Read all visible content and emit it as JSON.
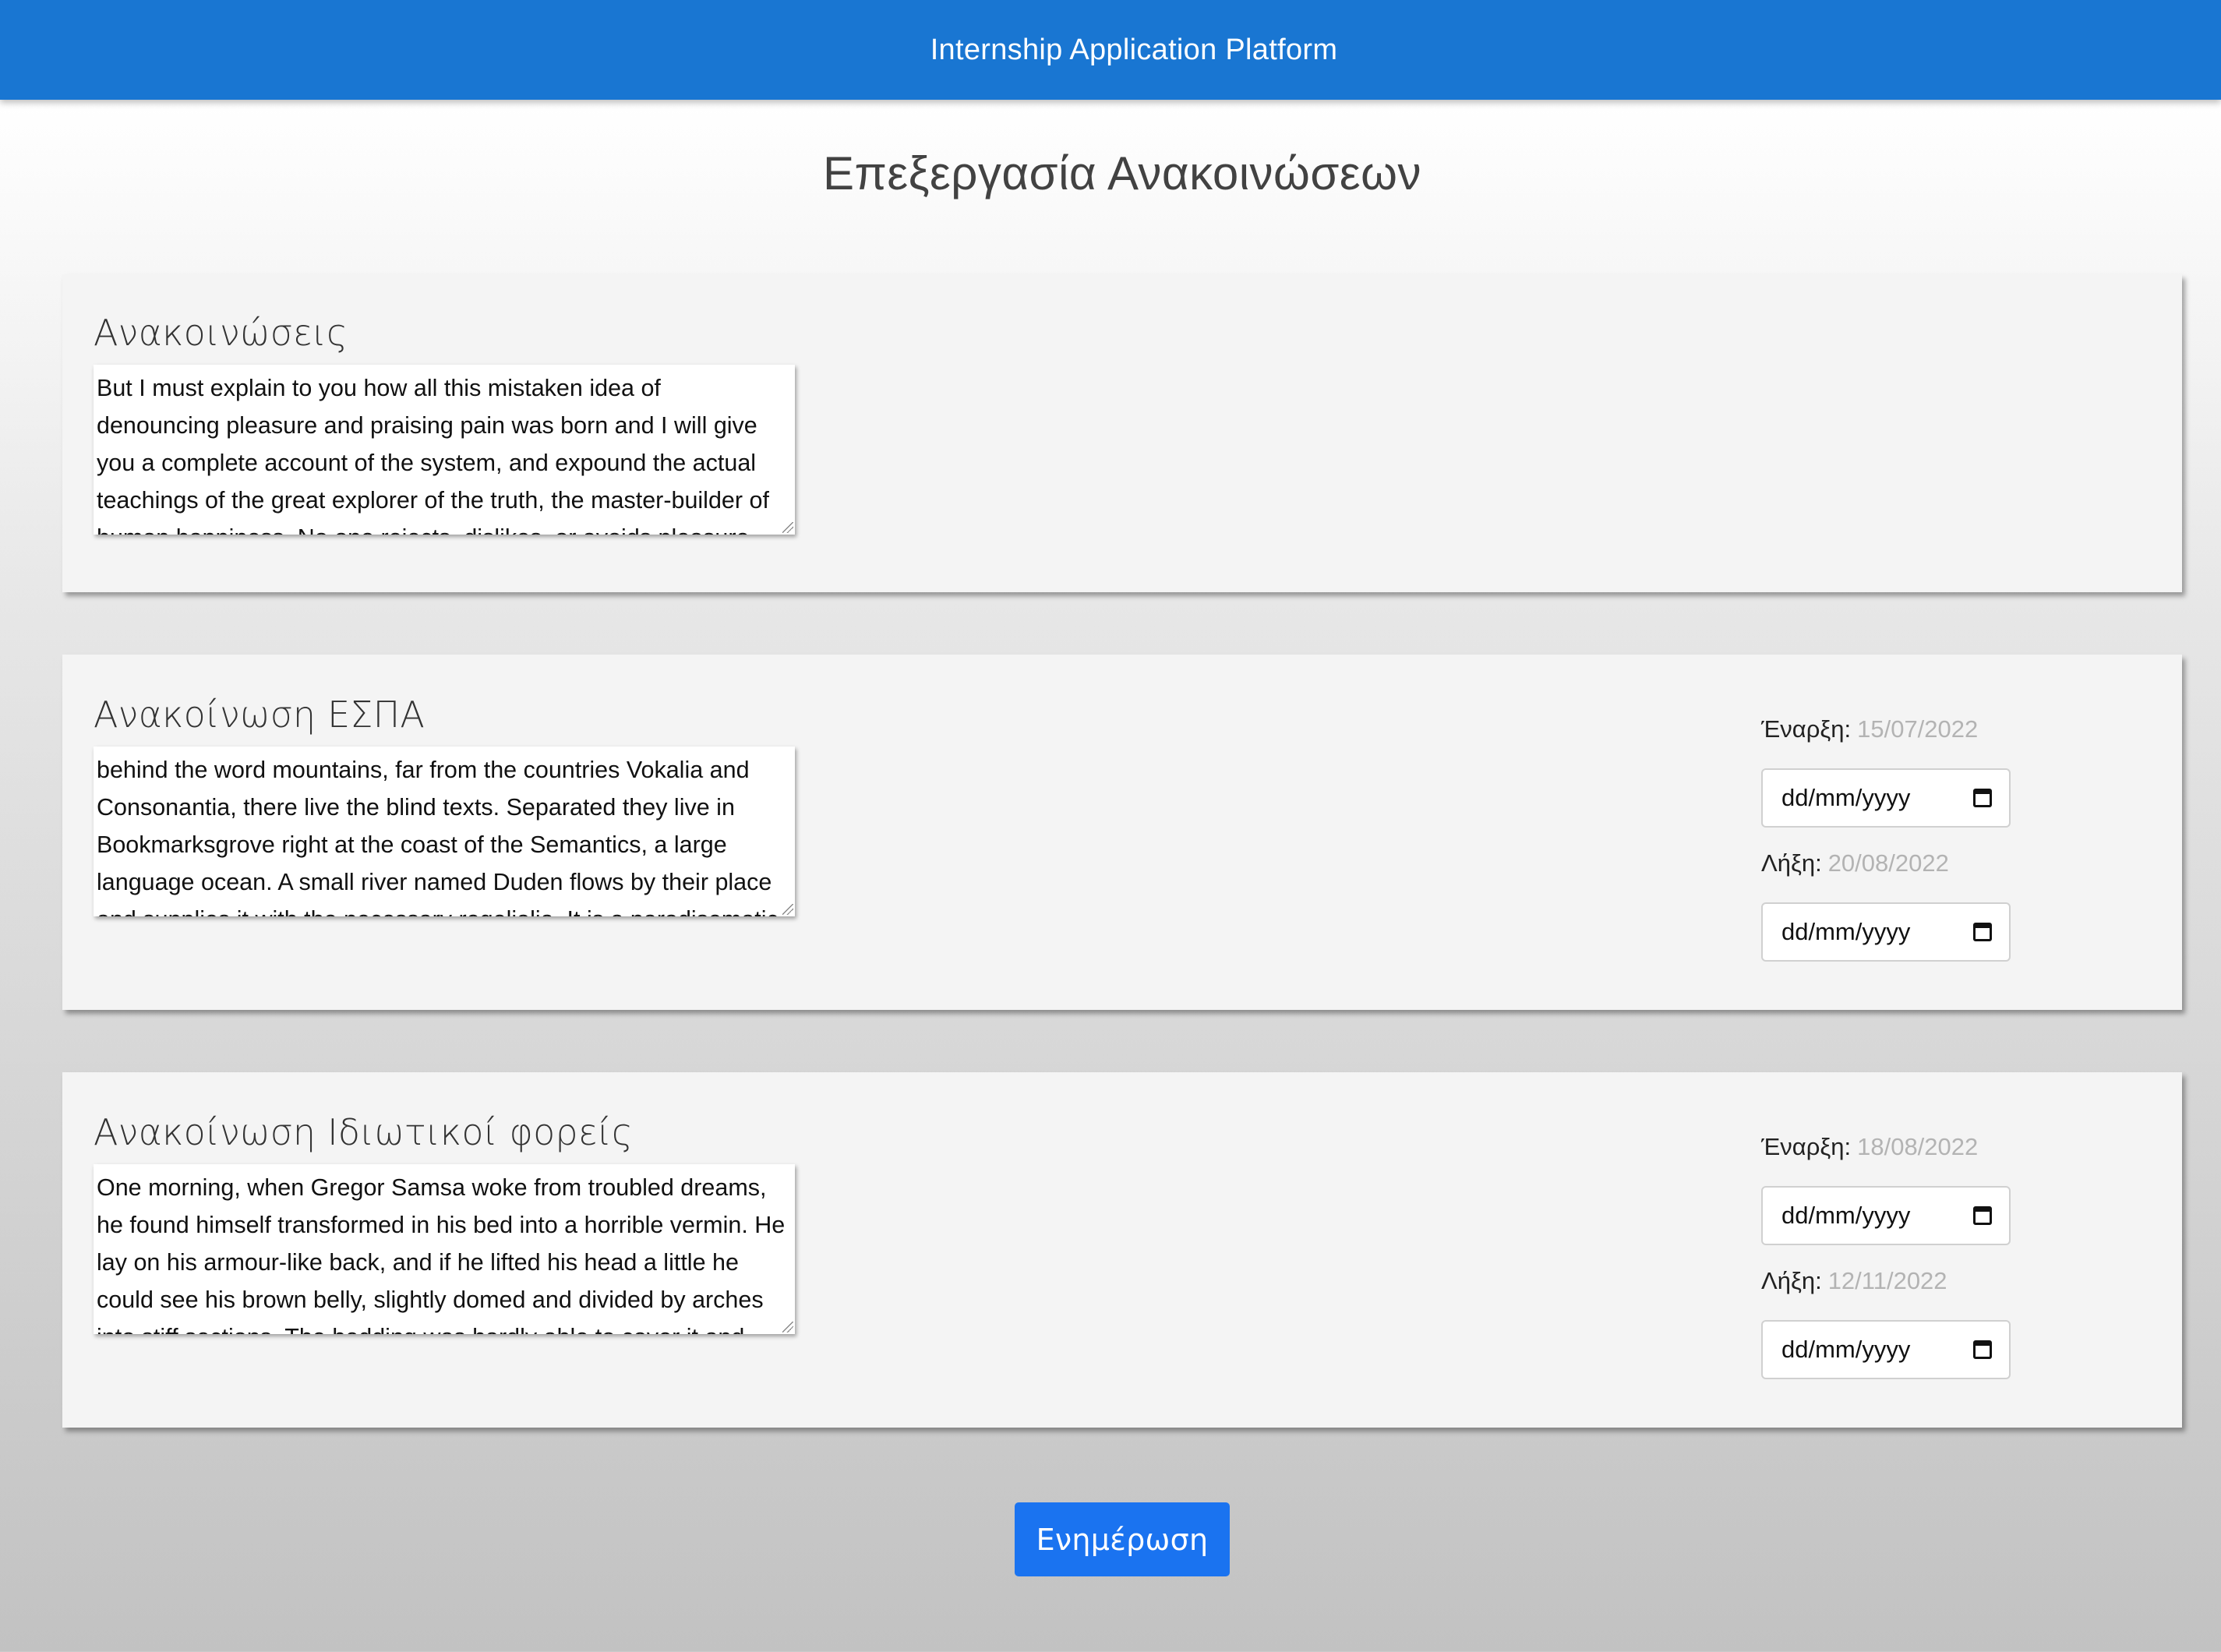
{
  "navbar": {
    "title": "Internship Application Platform"
  },
  "page": {
    "title": "Επεξεργασία Ανακοινώσεων"
  },
  "cards": [
    {
      "title": "Ανακοινώσεις",
      "text": "But I must explain to you how all this mistaken idea of denouncing pleasure and praising pain was born and I will give you a complete account of the system, and expound the actual teachings of the great explorer of the truth, the master-builder of human happiness. No one rejects, dislikes, or avoids pleasure itself, because it is pleasure, but because those who do not know how to pursue"
    },
    {
      "title": "Ανακοίνωση ΕΣΠΑ",
      "text": "behind the word mountains, far from the countries Vokalia and Consonantia, there live the blind texts. Separated they live in Bookmarksgrove right at the coast of the Semantics, a large language ocean. A small river named Duden flows by their place and supplies it with the necessary regelialia. It is a paradisematic country, in which roasted parts of sentences fly into your mouth",
      "start_label": "Έναρξη:",
      "start_value": "15/07/2022",
      "end_label": "Λήξη:",
      "end_value": "20/08/2022",
      "date_placeholder": "dd/mm/yyyy"
    },
    {
      "title": "Ανακοίνωση Ιδιωτικοί φορείς",
      "text": "One morning, when Gregor Samsa woke from troubled dreams, he found himself transformed in his bed into a horrible vermin. He lay on his armour-like back, and if he lifted his head a little he could see his brown belly, slightly domed and divided by arches into stiff sections. The bedding was hardly able to cover it and seemed ready to slide off any moment. His many legs, pitifully thin compared",
      "start_label": "Έναρξη:",
      "start_value": "18/08/2022",
      "end_label": "Λήξη:",
      "end_value": "12/11/2022",
      "date_placeholder": "dd/mm/yyyy"
    }
  ],
  "actions": {
    "update_label": "Ενημέρωση"
  },
  "icons": {
    "date_picker": "calendar-icon",
    "textarea_resize": "resize-grip-icon"
  },
  "colors": {
    "navbar": "#1976d2",
    "button": "#1a73f0",
    "date_value": "#b3b3b3"
  }
}
